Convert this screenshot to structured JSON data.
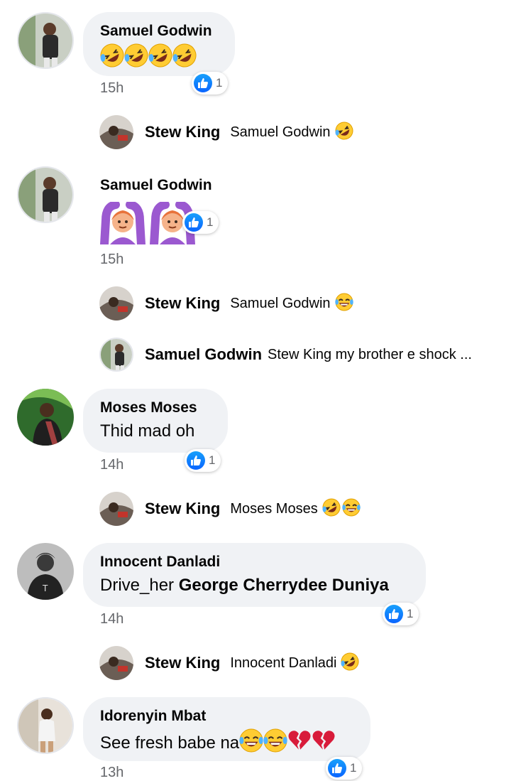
{
  "comments": [
    {
      "author": "Samuel Godwin",
      "time": "15h",
      "reaction_count": "1",
      "emojis": [
        "rofl",
        "rofl",
        "rofl",
        "rofl"
      ],
      "replies": [
        {
          "author": "Stew King",
          "text": "Samuel Godwin",
          "emojis": [
            "rofl"
          ]
        }
      ]
    },
    {
      "author": "Samuel Godwin",
      "time": "15h",
      "reaction_count": "1",
      "emojis": [
        "woman-gesturing-ok",
        "woman-gesturing-ok"
      ],
      "replies": [
        {
          "author": "Stew King",
          "text": "Samuel Godwin",
          "emojis": [
            "joy"
          ]
        },
        {
          "author": "Samuel Godwin",
          "text": "Stew King my brother e shock ..."
        }
      ]
    },
    {
      "author": "Moses Moses",
      "text": "Thid mad oh",
      "time": "14h",
      "reaction_count": "1",
      "replies": [
        {
          "author": "Stew King",
          "text": "Moses Moses",
          "emojis": [
            "rofl",
            "joy"
          ]
        }
      ]
    },
    {
      "author": "Innocent Danladi",
      "text": "Drive_her",
      "mention": "George Cherrydee Duniya",
      "time": "14h",
      "reaction_count": "1",
      "replies": [
        {
          "author": "Stew King",
          "text": "Innocent Danladi",
          "emojis": [
            "rofl"
          ]
        }
      ]
    },
    {
      "author": "Idorenyin Mbat",
      "text": "See fresh babe na",
      "emojis": [
        "joy",
        "joy",
        "broken-heart",
        "broken-heart"
      ],
      "time": "13h",
      "reaction_count": "1"
    }
  ],
  "colors": {
    "bubble": "#f0f2f5",
    "like_blue": "#1877f2",
    "meta": "#65676b",
    "emoji_yellow": "#ffcc33"
  }
}
